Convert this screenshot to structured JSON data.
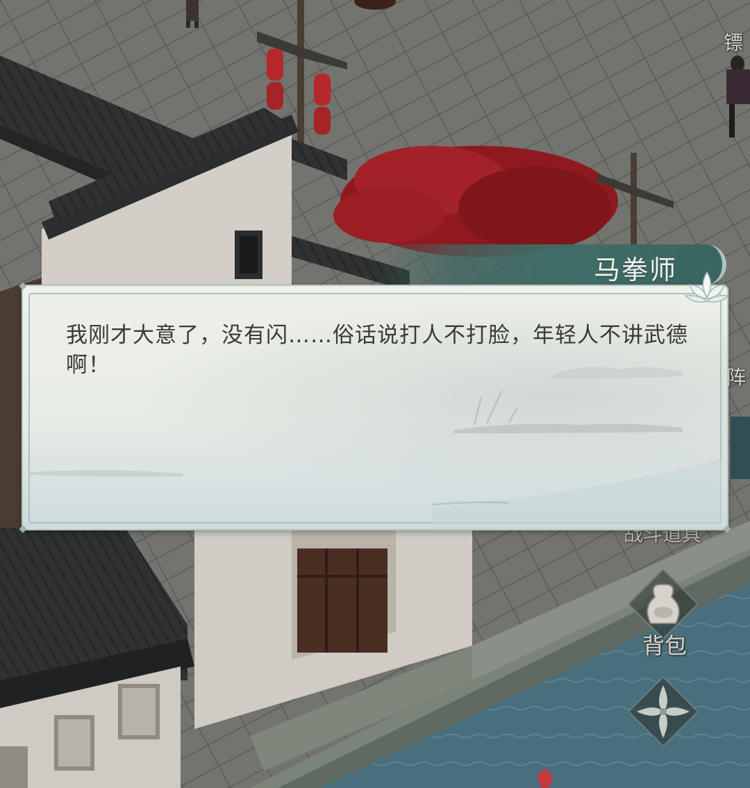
{
  "dialog": {
    "speaker": "马拳师",
    "text": "我刚才大意了，没有闪……俗话说打人不打脸，年轻人不讲武德啊！"
  },
  "map_labels": {
    "top_right": "镖",
    "mid_right": "阵"
  },
  "side_menu": {
    "tools_label": "战斗道具",
    "bag_label": "背包",
    "bag_icon": "money-bag-icon",
    "skill_icon": "flower-emblem-icon"
  },
  "colors": {
    "name_plate": "#3f6d68",
    "dialog_bg": "#e9ece6",
    "dialog_text": "#3b3a36",
    "maple_red": "#9c1d22",
    "lantern_red": "#b4282c"
  }
}
